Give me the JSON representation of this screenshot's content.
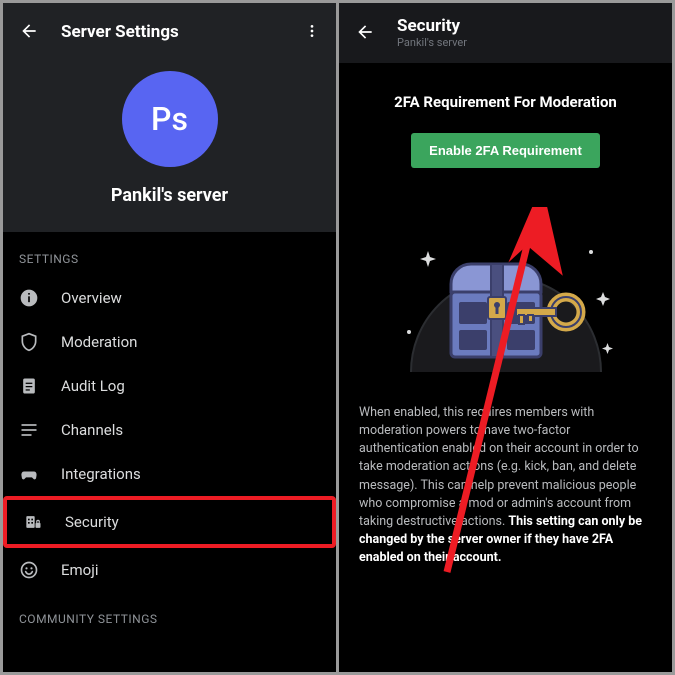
{
  "left": {
    "title": "Server Settings",
    "avatar_initials": "Ps",
    "server_name": "Pankil's server",
    "settings_label": "SETTINGS",
    "community_label": "COMMUNITY SETTINGS",
    "items": {
      "overview": "Overview",
      "moderation": "Moderation",
      "audit_log": "Audit Log",
      "channels": "Channels",
      "integrations": "Integrations",
      "security": "Security",
      "emoji": "Emoji"
    }
  },
  "right": {
    "title": "Security",
    "subtitle": "Pankil's server",
    "heading": "2FA Requirement For Moderation",
    "button_label": "Enable 2FA Requirement",
    "description_plain": "When enabled, this requires members with moderation powers to have two-factor authentication enabled on their account in order to take moderation actions (e.g. kick, ban, and delete message). This can help prevent malicious people who compromise a mod or admin's account from taking destructive actions. ",
    "description_bold": "This setting can only be changed by the server owner if they have 2FA enabled on their account."
  },
  "colors": {
    "accent_green": "#3ba55d",
    "blurple": "#5865f2",
    "annotation_red": "#ed1c24"
  }
}
